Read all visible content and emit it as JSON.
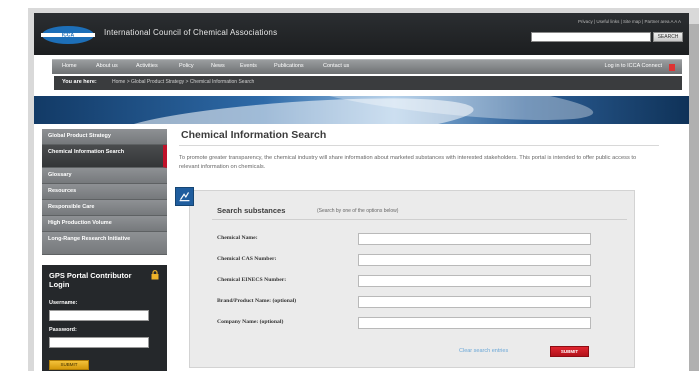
{
  "header": {
    "title": "International Council of Chemical Associations",
    "util_links": "Privacy | Useful links | Site map | Partner area  A  A  A",
    "search_button": "SEARCH"
  },
  "nav": {
    "items": [
      "Home",
      "About us",
      "Activities",
      "Policy",
      "News",
      "Events",
      "Publications",
      "Contact us"
    ],
    "login": "Log in to ICCA Connect"
  },
  "breadcrumb": {
    "label": "You are here:",
    "trail": "Home  >  Global Product Strategy  >  Chemical Information Search"
  },
  "sidebar": {
    "items": [
      {
        "label": "Global Product Strategy",
        "active": false
      },
      {
        "label": "Chemical Information Search",
        "active": true
      },
      {
        "label": "Glossary",
        "active": false
      },
      {
        "label": "Resources",
        "active": false
      },
      {
        "label": "Responsible Care",
        "active": false
      },
      {
        "label": "High Production Volume",
        "active": false
      },
      {
        "label": "Long-Range Research Initiative",
        "active": false
      }
    ],
    "login": {
      "title": "GPS Portal Contributor Login",
      "username_label": "Username:",
      "password_label": "Password:",
      "submit": "SUBMIT"
    }
  },
  "main": {
    "title": "Chemical Information Search",
    "intro": "To promote greater transparency, the chemical industry will share information about marketed substances with interested stakeholders. This portal is intended to offer public access to relevant information on chemicals.",
    "panel": {
      "title": "Search substances",
      "hint": "(Search by one of the options below)",
      "fields": [
        {
          "label": "Chemical Name:",
          "value": ""
        },
        {
          "label": "Chemical CAS Number:",
          "value": ""
        },
        {
          "label": "Chemical EINECS Number:",
          "value": ""
        },
        {
          "label": "Brand/Product Name: (optional)",
          "value": ""
        },
        {
          "label": "Company Name: (optional)",
          "value": ""
        }
      ],
      "clear_link": "Clear search entries",
      "submit": "SUBMIT"
    }
  },
  "colors": {
    "accent_red": "#c0122a",
    "header_dark": "#1c1e20",
    "panel_blue": "#1f5d9e",
    "submit_yellow": "#e0ac1f"
  }
}
